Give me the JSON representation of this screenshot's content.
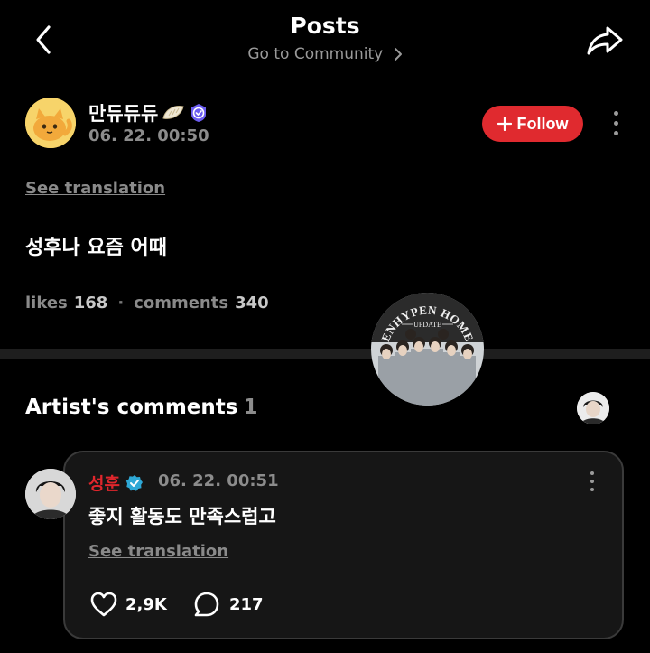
{
  "header": {
    "title": "Posts",
    "subtitle": "Go to Community"
  },
  "post": {
    "author": "만듀듀듀",
    "date": "06. 22. 00:50",
    "follow_label": "Follow",
    "see_translation": "See translation",
    "body": "성후나 요즘 어때",
    "likes_label": "likes",
    "likes_count": "168",
    "comments_label": "comments",
    "comments_count": "340"
  },
  "badge": {
    "line1": "ENHYPEN HOME",
    "line2": "UPDATE"
  },
  "artist_comments": {
    "title": "Artist's comments",
    "count": "1"
  },
  "comment": {
    "author": "성훈",
    "date": "06. 22. 00:51",
    "body": "좋지 활동도 만족스럽고",
    "see_translation": "See translation",
    "likes": "2,9K",
    "replies": "217"
  },
  "colors": {
    "background": "#000000",
    "accent_red": "#e02a2f",
    "verified_blue": "#2ea8d6",
    "muted": "#8a8a8a"
  },
  "icons": [
    "back-arrow-icon",
    "chevron-right-icon",
    "share-icon",
    "plus-icon",
    "verified-icon",
    "kebab-icon",
    "heart-icon",
    "comment-icon"
  ]
}
